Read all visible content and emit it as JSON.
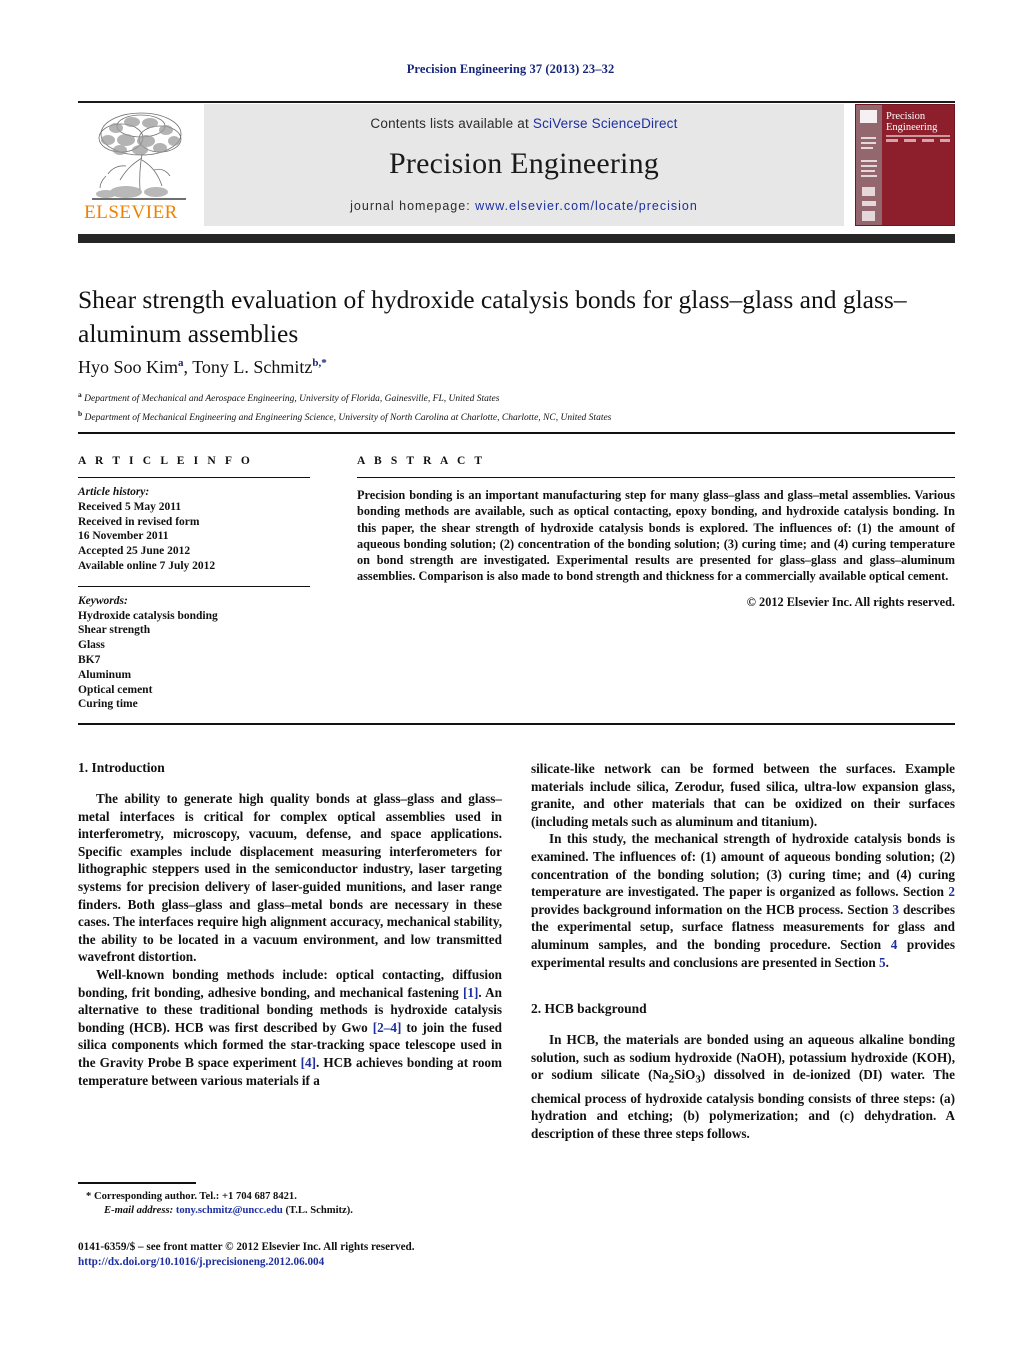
{
  "running_head": "Precision Engineering 37 (2013) 23–32",
  "header": {
    "contents_prefix": "Contents lists available at ",
    "contents_link": "SciVerse ScienceDirect",
    "journal_title": "Precision Engineering",
    "homepage_prefix": "journal homepage: ",
    "homepage_url": "www.elsevier.com/locate/precision",
    "publisher_wordmark": "ELSEVIER",
    "cover_title_line1": "Precision",
    "cover_title_line2": "Engineering",
    "accent_link_color": "#1d2f9e",
    "cover_color": "#8d1f2c",
    "band_color": "#e7e7e8",
    "wordmark_color": "#f08000"
  },
  "article": {
    "title": "Shear strength evaluation of hydroxide catalysis bonds for glass–glass and glass–aluminum assemblies",
    "authors_html": "Hyo Soo Kim<sup>a</sup>, Tony L. Schmitz<sup>b,</sup><sup>*</sup>",
    "affiliation_a": "Department of Mechanical and Aerospace Engineering, University of Florida, Gainesville, FL, United States",
    "affiliation_b": "Department of Mechanical Engineering and Engineering Science, University of North Carolina at Charlotte, Charlotte, NC, United States"
  },
  "info": {
    "heading": "A R T I C L E   I N F O",
    "history_label": "Article history:",
    "history": [
      "Received 5 May 2011",
      "Received in revised form",
      "16 November 2011",
      "Accepted 25 June 2012",
      "Available online 7 July 2012"
    ],
    "keywords_label": "Keywords:",
    "keywords": [
      "Hydroxide catalysis bonding",
      "Shear strength",
      "Glass",
      "BK7",
      "Aluminum",
      "Optical cement",
      "Curing time"
    ]
  },
  "abstract": {
    "heading": "A B S T R A C T",
    "text": "Precision bonding is an important manufacturing step for many glass–glass and glass–metal assemblies. Various bonding methods are available, such as optical contacting, epoxy bonding, and hydroxide catalysis bonding. In this paper, the shear strength of hydroxide catalysis bonds is explored. The influences of: (1) the amount of aqueous bonding solution; (2) concentration of the bonding solution; (3) curing time; and (4) curing temperature on bond strength are investigated. Experimental results are presented for glass–glass and glass–aluminum assemblies. Comparison is also made to bond strength and thickness for a commercially available optical cement.",
    "copyright": "© 2012 Elsevier Inc. All rights reserved."
  },
  "body": {
    "section1_heading": "1.  Introduction",
    "p1": "The ability to generate high quality bonds at glass–glass and glass–metal interfaces is critical for complex optical assemblies used in interferometry, microscopy, vacuum, defense, and space applications. Specific examples include displacement measuring interferometers for lithographic steppers used in the semiconductor industry, laser targeting systems for precision delivery of laser-guided munitions, and laser range finders. Both glass–glass and glass–metal bonds are necessary in these cases. The interfaces require high alignment accuracy, mechanical stability, the ability to be located in a vacuum environment, and low transmitted wavefront distortion.",
    "p2_a": "Well-known bonding methods include: optical contacting, diffusion bonding, frit bonding, adhesive bonding, and mechanical fastening ",
    "p2_ref1": "[1]",
    "p2_b": ". An alternative to these traditional bonding methods is hydroxide catalysis bonding (HCB). HCB was first described by Gwo ",
    "p2_ref2": "[2–4]",
    "p2_c": " to join the fused silica components which formed the star-tracking space telescope used in the Gravity Probe B space experiment ",
    "p2_ref3": "[4]",
    "p2_d": ". HCB achieves bonding at room temperature between various materials if a",
    "p3": "silicate-like network can be formed between the surfaces. Example materials include silica, Zerodur, fused silica, ultra-low expansion glass, granite, and other materials that can be oxidized on their surfaces (including metals such as aluminum and titanium).",
    "p4_a": "In this study, the mechanical strength of hydroxide catalysis bonds is examined. The influences of: (1) amount of aqueous bonding solution; (2) concentration of the bonding solution; (3) curing time; and (4) curing temperature are investigated. The paper is organized as follows. Section ",
    "p4_ref1": "2",
    "p4_b": " provides background information on the HCB process. Section ",
    "p4_ref2": "3",
    "p4_c": " describes the experimental setup, surface flatness measurements for glass and aluminum samples, and the bonding procedure. Section ",
    "p4_ref3": "4",
    "p4_d": " provides experimental results and conclusions are presented in Section ",
    "p4_ref4": "5",
    "p4_e": ".",
    "section2_heading": "2.  HCB background",
    "p5_a": "In HCB, the materials are bonded using an aqueous alkaline bonding solution, such as sodium hydroxide (NaOH), potassium hydroxide (KOH), or sodium silicate (Na",
    "p5_sub1": "2",
    "p5_b": "SiO",
    "p5_sub2": "3",
    "p5_c": ") dissolved in de-ionized (DI) water. The chemical process of hydroxide catalysis bonding consists of three steps: (a) hydration and etching; (b) polymerization; and (c) dehydration. A description of these three steps follows."
  },
  "footer": {
    "corresponding": "* Corresponding author. Tel.: +1 704 687 8421.",
    "email_label": "E-mail address:",
    "email": "tony.schmitz@uncc.edu",
    "email_suffix": "(T.L. Schmitz).",
    "issn_line": "0141-6359/$ – see front matter © 2012 Elsevier Inc. All rights reserved.",
    "doi": "http://dx.doi.org/10.1016/j.precisioneng.2012.06.004"
  }
}
